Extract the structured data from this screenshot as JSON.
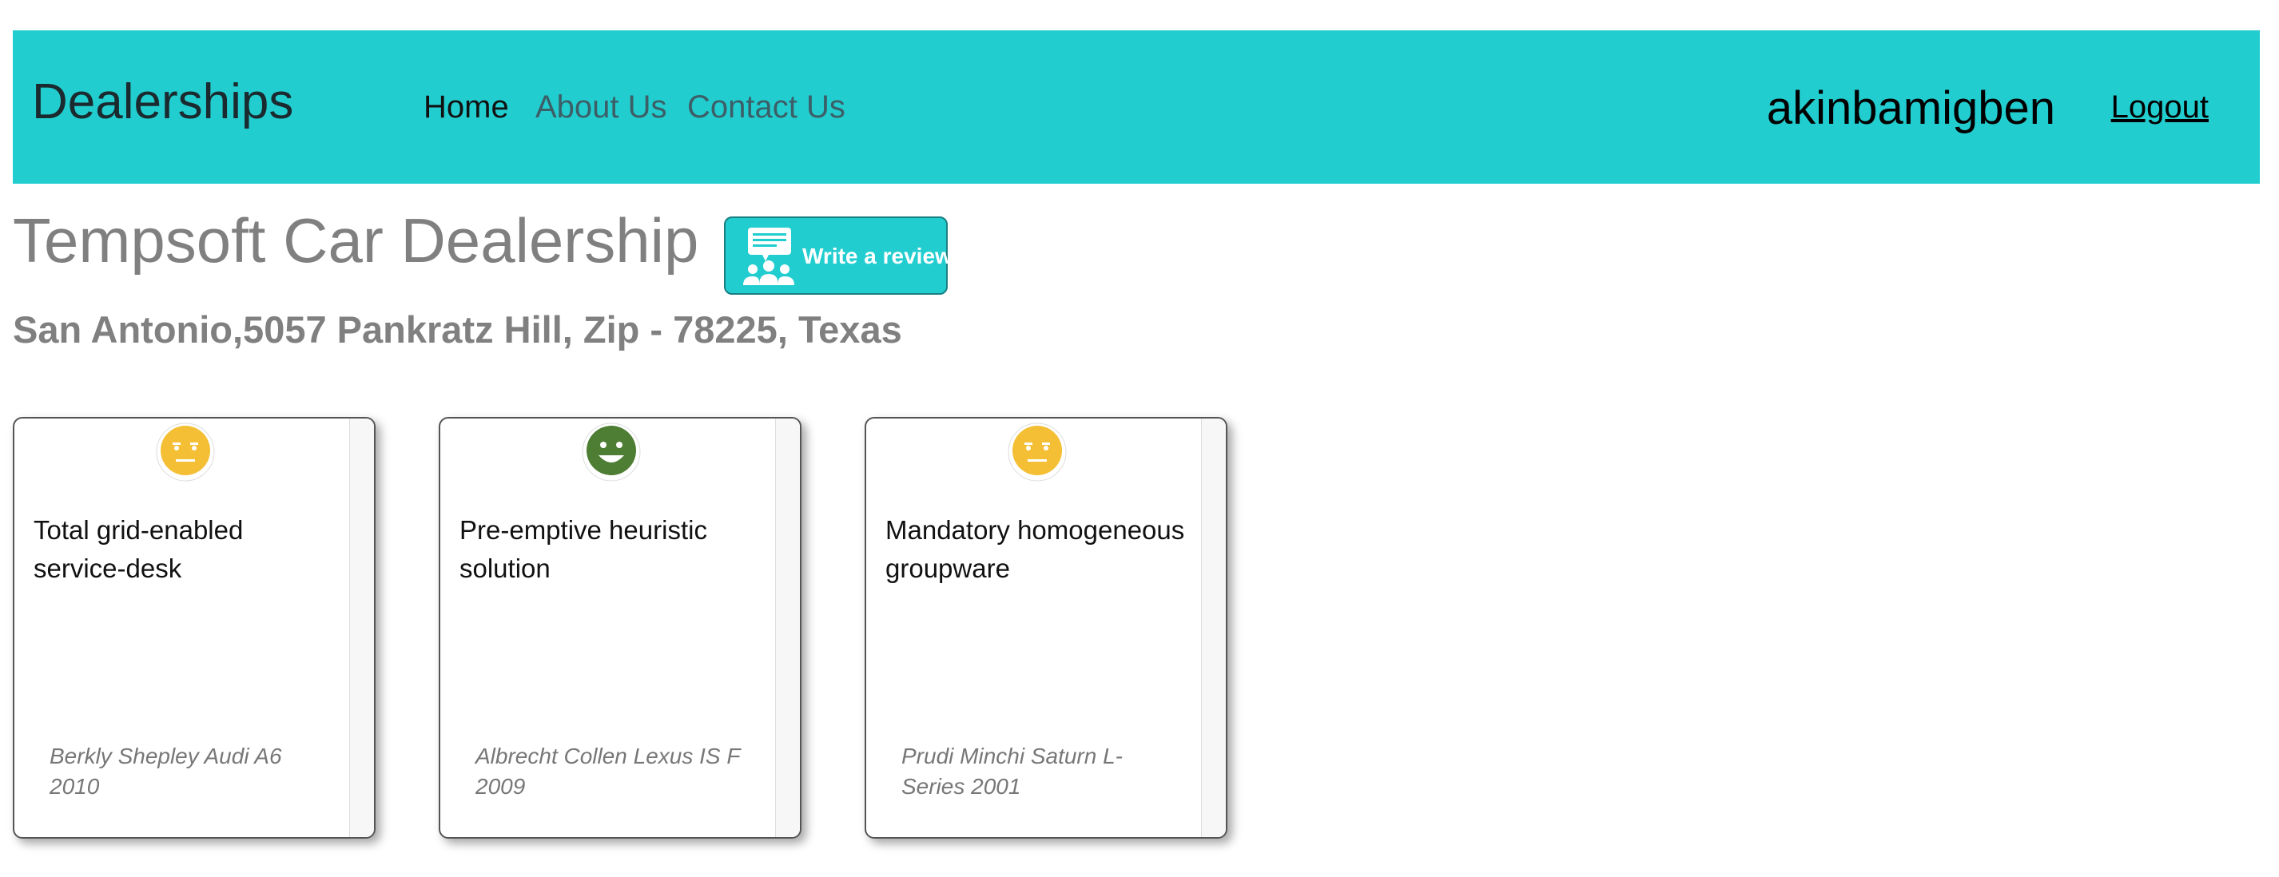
{
  "navbar": {
    "brand": "Dealerships",
    "links": [
      "Home",
      "About Us",
      "Contact Us"
    ],
    "username": "akinbamigben",
    "logout": "Logout",
    "bg_color": "#22cdd0"
  },
  "dealer": {
    "name": "Tempsoft Car Dealership",
    "address": "San Antonio,5057 Pankratz Hill, Zip - 78225, Texas",
    "write_review": "Write a review"
  },
  "reviews": [
    {
      "sentiment": "neutral",
      "icon": "neutral-face-icon",
      "text": "Total grid-enabled service-desk",
      "meta": "Berkly Shepley Audi A6 2010"
    },
    {
      "sentiment": "positive",
      "icon": "happy-face-icon",
      "text": "Pre-emptive heuristic solution",
      "meta": "Albrecht Collen Lexus IS F 2009"
    },
    {
      "sentiment": "neutral",
      "icon": "neutral-face-icon",
      "text": "Mandatory homogeneous groupware",
      "meta": "Prudi Minchi Saturn L-Series 2001"
    }
  ],
  "colors": {
    "neutral": "#f4bf34",
    "positive": "#4e7d34"
  }
}
